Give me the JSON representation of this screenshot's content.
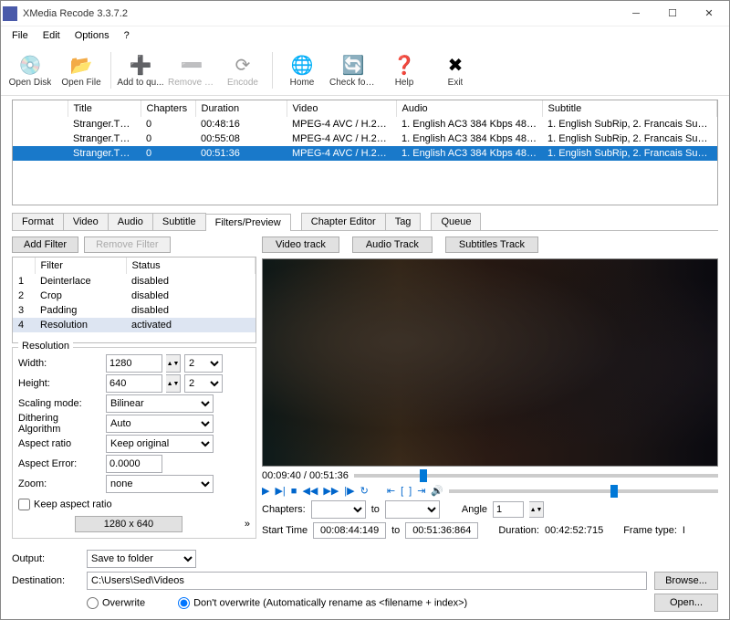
{
  "title": "XMedia Recode 3.3.7.2",
  "menu": [
    "File",
    "Edit",
    "Options",
    "?"
  ],
  "toolbar": [
    {
      "id": "open-disk",
      "label": "Open Disk",
      "icon": "💿",
      "enabled": true
    },
    {
      "id": "open-file",
      "label": "Open File",
      "icon": "📂",
      "enabled": true
    },
    {
      "id": "add-queue",
      "label": "Add to qu...",
      "icon": "➕",
      "enabled": true
    },
    {
      "id": "remove-job",
      "label": "Remove Job",
      "icon": "➖",
      "enabled": false
    },
    {
      "id": "encode",
      "label": "Encode",
      "icon": "⟳",
      "enabled": false
    },
    {
      "id": "home",
      "label": "Home",
      "icon": "🌐",
      "enabled": true
    },
    {
      "id": "check-update",
      "label": "Check for ...",
      "icon": "🔄",
      "enabled": true
    },
    {
      "id": "help",
      "label": "Help",
      "icon": "❓",
      "enabled": true
    },
    {
      "id": "exit",
      "label": "Exit",
      "icon": "✖",
      "enabled": true
    }
  ],
  "cols": [
    "Title",
    "Chapters",
    "Duration",
    "Video",
    "Audio",
    "Subtitle"
  ],
  "rows": [
    {
      "sel": false,
      "c": [
        "Stranger.Things...",
        "0",
        "00:48:16",
        "MPEG-4 AVC / H.264 23.9...",
        "1. English AC3 384 Kbps 48000 Hz 6 ...",
        "1. English SubRip, 2. Francais SubRi..."
      ]
    },
    {
      "sel": false,
      "c": [
        "Stranger.Things...",
        "0",
        "00:55:08",
        "MPEG-4 AVC / H.264 23.9...",
        "1. English AC3 384 Kbps 48000 Hz 6 ...",
        "1. English SubRip, 2. Francais SubRi..."
      ]
    },
    {
      "sel": true,
      "c": [
        "Stranger.Things...",
        "0",
        "00:51:36",
        "MPEG-4 AVC / H.264 23.9...",
        "1. English AC3 384 Kbps 48000 Hz 6 ...",
        "1. English SubRip, 2. Francais SubRi..."
      ]
    }
  ],
  "tabs": [
    "Format",
    "Video",
    "Audio",
    "Subtitle",
    "Filters/Preview",
    "Chapter Editor",
    "Tag",
    "Queue"
  ],
  "activetab": 4,
  "filterbtns": {
    "add": "Add Filter",
    "remove": "Remove Filter"
  },
  "filtercols": [
    "",
    "Filter",
    "Status"
  ],
  "filters": [
    {
      "n": "1",
      "name": "Deinterlace",
      "status": "disabled"
    },
    {
      "n": "2",
      "name": "Crop",
      "status": "disabled"
    },
    {
      "n": "3",
      "name": "Padding",
      "status": "disabled"
    },
    {
      "n": "4",
      "name": "Resolution",
      "status": "activated",
      "sel": true
    }
  ],
  "res": {
    "caption": "Resolution",
    "width_lbl": "Width:",
    "width": "1280",
    "width_div": "2",
    "height_lbl": "Height:",
    "height": "640",
    "height_div": "2",
    "scaling_lbl": "Scaling mode:",
    "scaling": "Bilinear",
    "dither_lbl": "Dithering Algorithm",
    "dither": "Auto",
    "aspect_lbl": "Aspect ratio",
    "aspect": "Keep original",
    "error_lbl": "Aspect Error:",
    "error": "0.0000",
    "zoom_lbl": "Zoom:",
    "zoom": "none",
    "keep_lbl": "Keep aspect ratio",
    "sizebtn": "1280 x 640"
  },
  "tracks": {
    "video": "Video track",
    "audio": "Audio Track",
    "sub": "Subtitles Track"
  },
  "preview": {
    "pos": "00:09:40 / 00:51:36",
    "chapters_lbl": "Chapters:",
    "to": "to",
    "angle_lbl": "Angle",
    "angle": "1",
    "start_lbl": "Start Time",
    "start": "00:08:44:149",
    "end": "00:51:36:864",
    "dur_lbl": "Duration:",
    "dur": "00:42:52:715",
    "frame_lbl": "Frame type:",
    "frame": "I"
  },
  "output": {
    "out_lbl": "Output:",
    "out_val": "Save to folder",
    "dest_lbl": "Destination:",
    "dest_val": "C:\\Users\\Sed\\Videos",
    "browse": "Browse...",
    "open": "Open...",
    "overwrite": "Overwrite",
    "dont": "Don't overwrite (Automatically rename as <filename + index>)"
  }
}
